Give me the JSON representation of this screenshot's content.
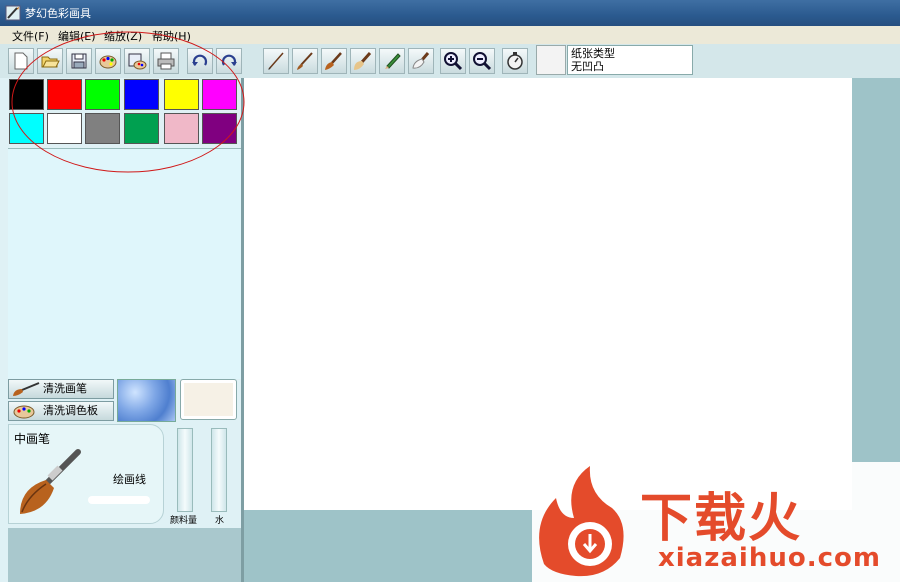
{
  "window": {
    "title": "梦幻色彩画具"
  },
  "menu": [
    {
      "label": "文件(F)"
    },
    {
      "label": "编辑(E)"
    },
    {
      "label": "缩放(Z)"
    },
    {
      "label": "帮助(H)"
    }
  ],
  "toolbar": {
    "file_icons": [
      "new-file-icon",
      "open-folder-icon",
      "save-icon",
      "palette-icon",
      "save-palette-icon",
      "printer-icon",
      "undo-icon",
      "redo-icon"
    ],
    "brush_icons": [
      "thin-brush-icon",
      "small-brush-icon",
      "medium-brush-icon",
      "large-brush-icon",
      "pencil-icon",
      "eraser-icon",
      "zoom-in-icon",
      "zoom-out-icon",
      "stopwatch-icon"
    ],
    "paper": {
      "type_label": "纸张类型",
      "type_value": "无凹凸"
    }
  },
  "palette": {
    "colors": [
      "#000000",
      "#ff0000",
      "#00ff00",
      "#0000ff",
      "#ffff00",
      "#ff00ff",
      "#00ffff",
      "#ffffff",
      "#808080",
      "#00a050",
      "#f0b8c8",
      "#800080"
    ]
  },
  "left_panel": {
    "clean_brush_label": "清洗画笔",
    "clean_palette_label": "清洗调色板",
    "brush_name": "中画笔",
    "draw_line_label": "绘画线",
    "paint_amount_label": "颜料量",
    "water_label": "水"
  },
  "watermark": {
    "brand": "下载火",
    "domain": "xiazaihuo.com"
  }
}
